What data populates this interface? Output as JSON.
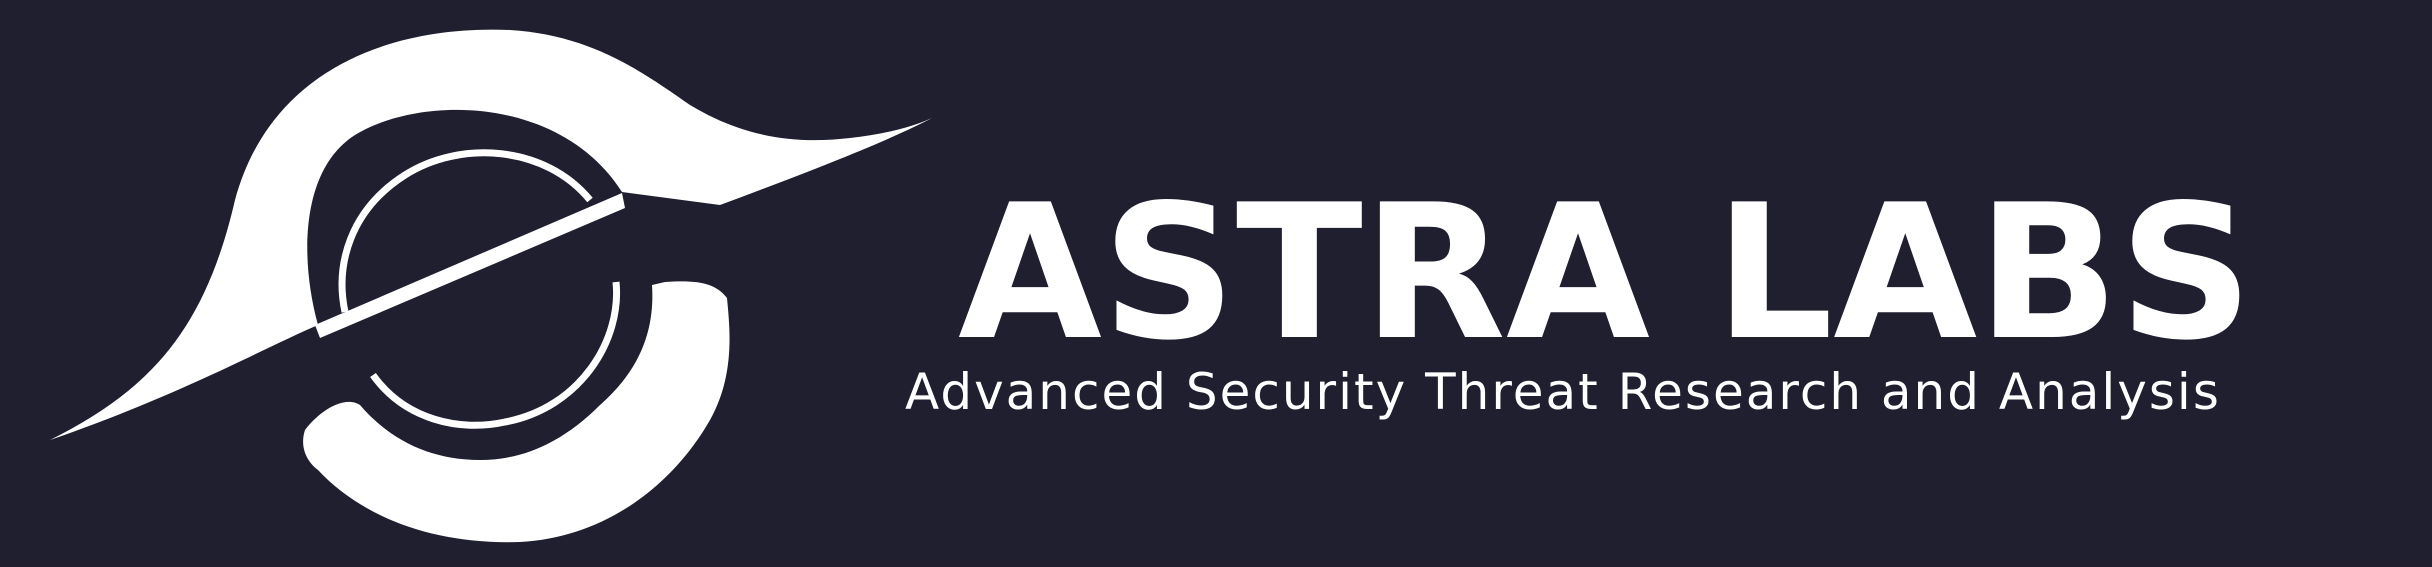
{
  "brand": {
    "name": "ASTRA LABS",
    "tagline": "Advanced Security Threat Research and Analysis",
    "logo_icon": "stylized-eye-swoosh-logo"
  },
  "colors": {
    "background": "#1f1f30",
    "foreground": "#ffffff"
  }
}
